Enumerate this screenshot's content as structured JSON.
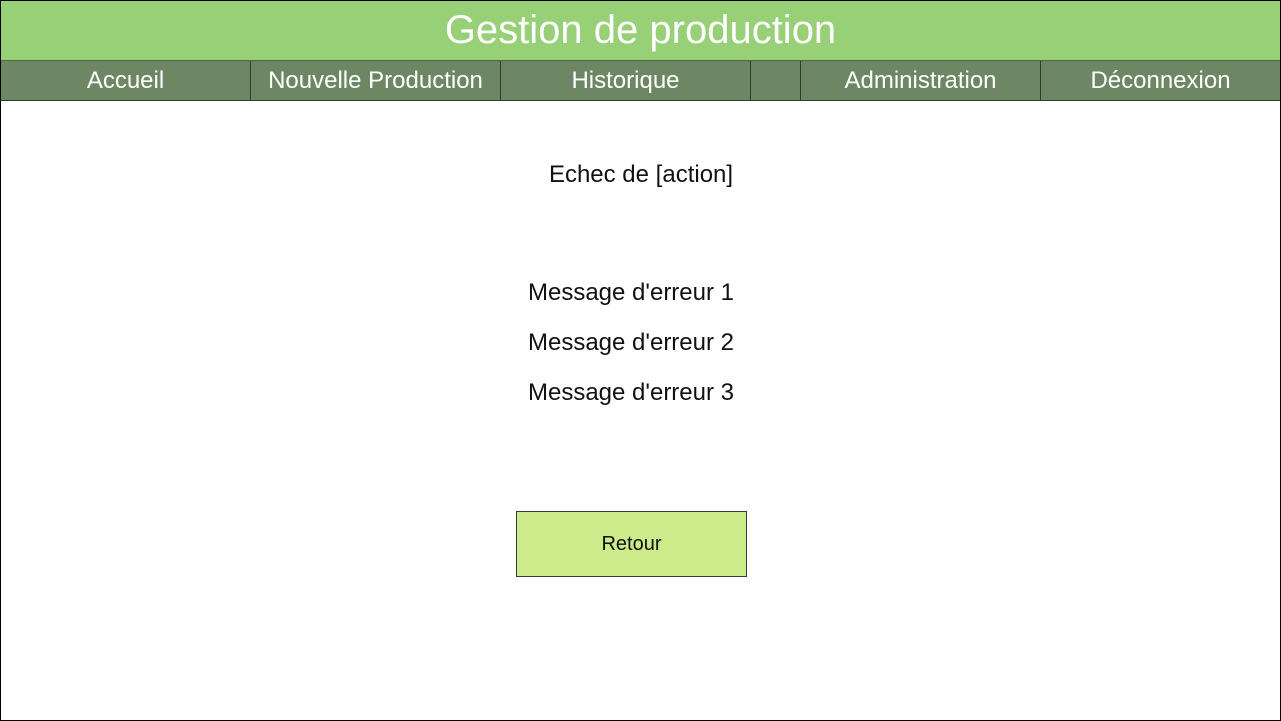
{
  "header": {
    "title": "Gestion de production"
  },
  "nav": {
    "items": [
      {
        "label": "Accueil"
      },
      {
        "label": "Nouvelle Production"
      },
      {
        "label": "Historique"
      },
      {
        "label": "Administration"
      },
      {
        "label": "Déconnexion"
      }
    ]
  },
  "main": {
    "status_title": "Echec de [action]",
    "messages": [
      "Message d'erreur 1",
      "Message d'erreur 2",
      "Message d'erreur 3"
    ],
    "back_label": "Retour"
  },
  "colors": {
    "header_bg": "#97d077",
    "nav_bg": "#6d8764",
    "button_bg": "#cdeb8b"
  }
}
